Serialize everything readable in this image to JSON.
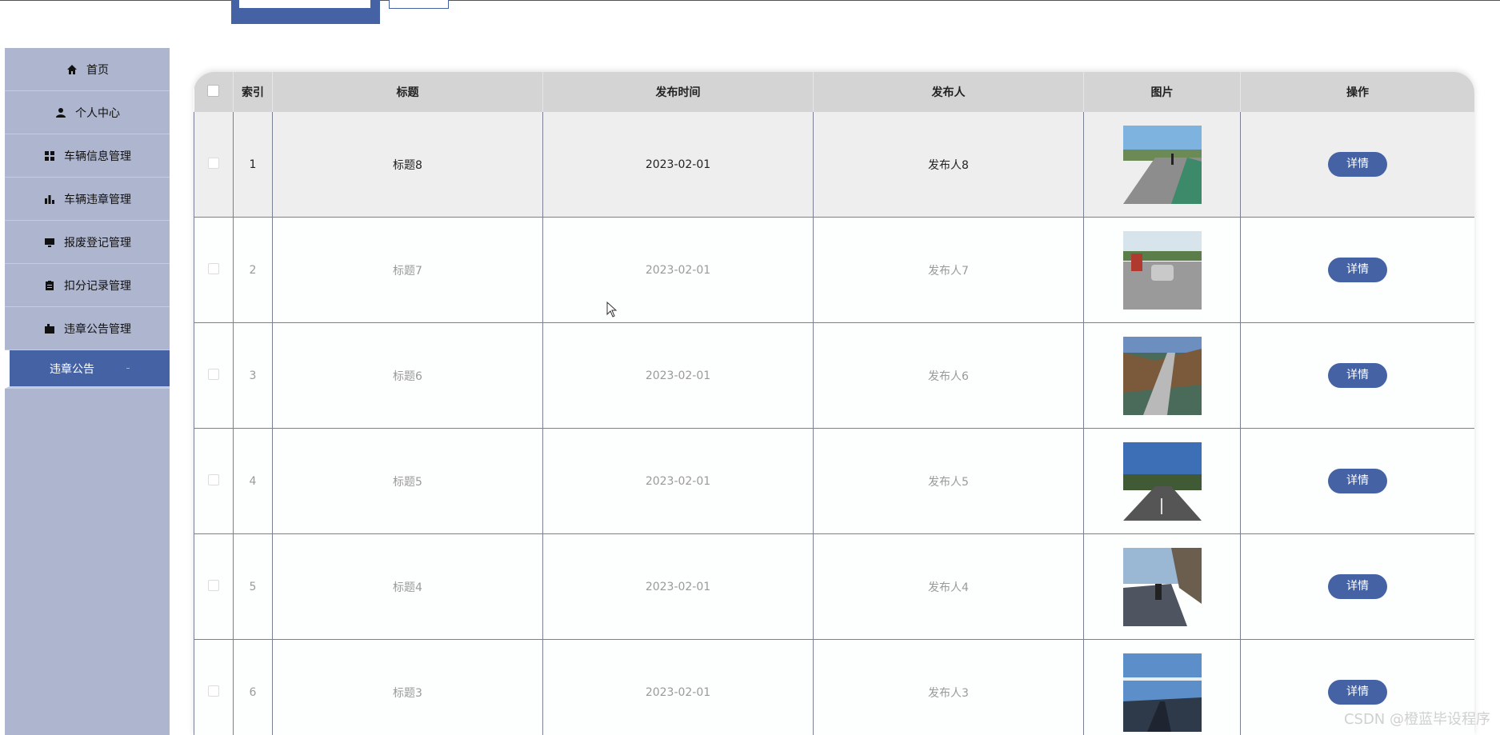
{
  "sidebar": {
    "items": [
      {
        "label": "首页",
        "icon": "home-icon"
      },
      {
        "label": "个人中心",
        "icon": "user-icon"
      },
      {
        "label": "车辆信息管理",
        "icon": "grid-icon"
      },
      {
        "label": "车辆违章管理",
        "icon": "bar-chart-icon"
      },
      {
        "label": "报废登记管理",
        "icon": "monitor-icon"
      },
      {
        "label": "扣分记录管理",
        "icon": "clipboard-icon"
      },
      {
        "label": "违章公告管理",
        "icon": "briefcase-icon"
      },
      {
        "label": "违章公告",
        "icon": ""
      }
    ]
  },
  "table": {
    "headers": [
      "索引",
      "标题",
      "发布时间",
      "发布人",
      "图片",
      "操作"
    ],
    "rows": [
      {
        "index": "1",
        "title": "标题8",
        "time": "2023-02-01",
        "author": "发布人8",
        "action": "详情"
      },
      {
        "index": "2",
        "title": "标题7",
        "time": "2023-02-01",
        "author": "发布人7",
        "action": "详情"
      },
      {
        "index": "3",
        "title": "标题6",
        "time": "2023-02-01",
        "author": "发布人6",
        "action": "详情"
      },
      {
        "index": "4",
        "title": "标题5",
        "time": "2023-02-01",
        "author": "发布人5",
        "action": "详情"
      },
      {
        "index": "5",
        "title": "标题4",
        "time": "2023-02-01",
        "author": "发布人4",
        "action": "详情"
      },
      {
        "index": "6",
        "title": "标题3",
        "time": "2023-02-01",
        "author": "发布人3",
        "action": "详情"
      }
    ]
  },
  "watermark": "CSDN @橙蓝毕设程序",
  "colors": {
    "primary": "#4563a4",
    "sidebar_bg": "#aeb5cf",
    "header_bg": "#d4d4d4"
  }
}
